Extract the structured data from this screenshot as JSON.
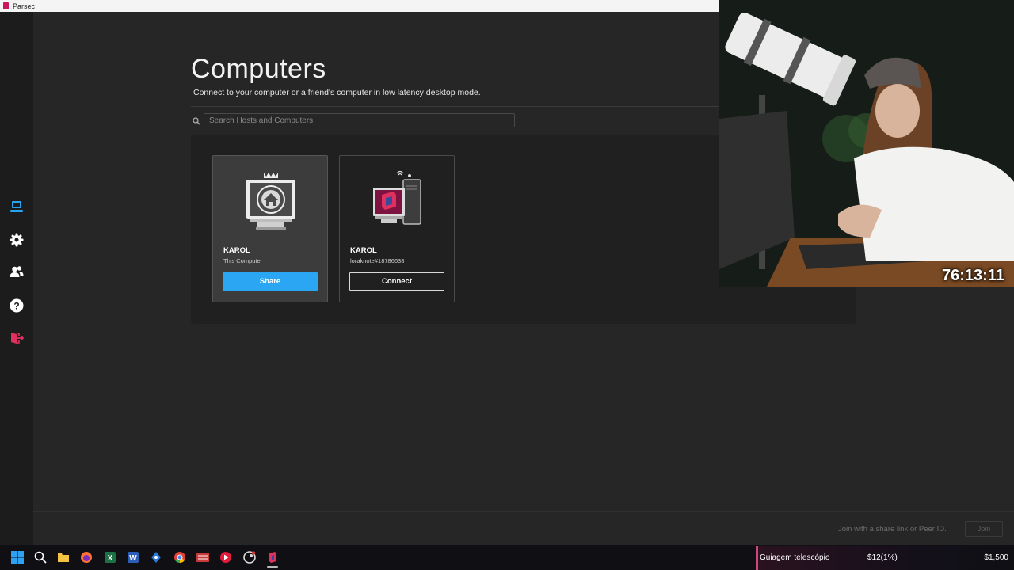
{
  "window": {
    "title": "Parsec"
  },
  "page": {
    "title": "Computers",
    "subtitle": "Connect to your computer or a friend's computer in low latency desktop mode."
  },
  "search": {
    "placeholder": "Search Hosts and Computers"
  },
  "sidebar": {
    "items": [
      {
        "icon": "computer-icon",
        "active": true
      },
      {
        "icon": "gear-icon",
        "active": false
      },
      {
        "icon": "friends-icon",
        "active": false
      },
      {
        "icon": "help-icon",
        "active": false
      },
      {
        "icon": "logout-icon",
        "active": false
      }
    ]
  },
  "computers": [
    {
      "name": "KAROL",
      "subtitle": "This Computer",
      "button": "Share"
    },
    {
      "name": "KAROL",
      "subtitle": "loraknote#18786638",
      "button": "Connect"
    }
  ],
  "join": {
    "placeholder": "Join with a share link or Peer ID.",
    "button": "Join"
  },
  "webcam": {
    "timer": "76:13:11"
  },
  "ticker": {
    "goal": "Guiagem telescópio",
    "progress": "$12(1%)",
    "target": "$1,500"
  },
  "taskbar": {
    "icons": [
      "windows-start-icon",
      "search-icon",
      "file-explorer-icon",
      "firefox-icon",
      "excel-icon",
      "word-icon",
      "sourcetree-icon",
      "chrome-icon",
      "voicemeeter-icon",
      "media-player-icon",
      "steam-icon",
      "parsec-icon"
    ]
  },
  "colors": {
    "accent": "#2aa6f2",
    "brand": "#c8175e",
    "background": "#262626"
  }
}
